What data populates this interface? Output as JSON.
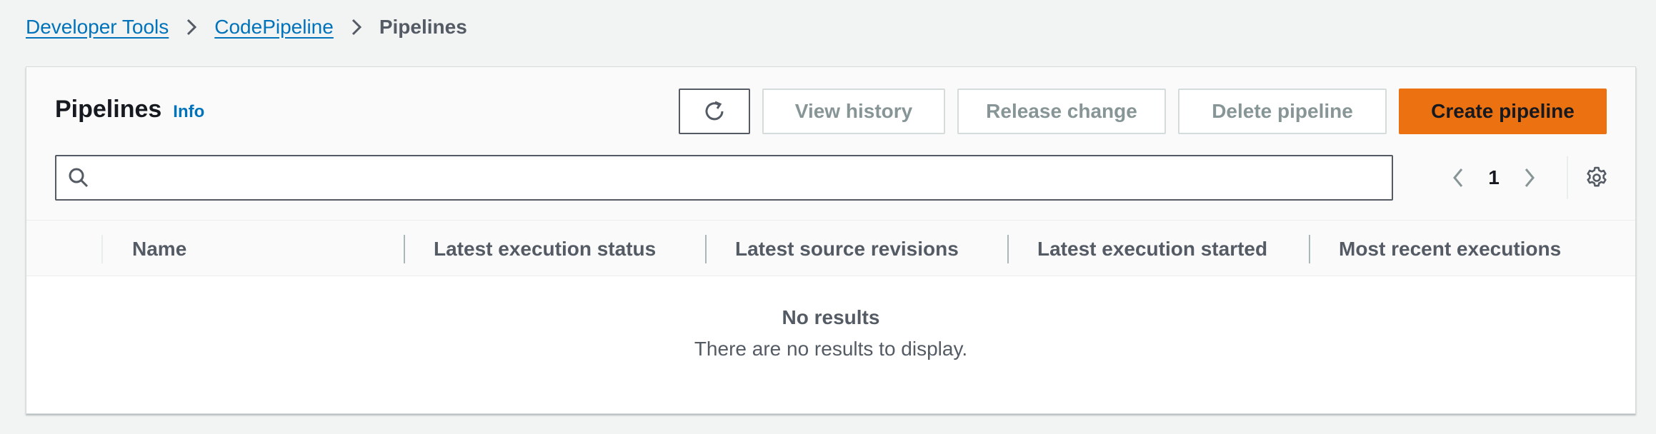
{
  "breadcrumb": {
    "items": [
      "Developer Tools",
      "CodePipeline"
    ],
    "current": "Pipelines"
  },
  "panel": {
    "title": "Pipelines",
    "info": "Info",
    "buttons": {
      "refresh_icon": "refresh-icon",
      "view_history": "View history",
      "release_change": "Release change",
      "delete_pipeline": "Delete pipeline",
      "create_pipeline": "Create pipeline"
    },
    "search": {
      "value": "",
      "placeholder": "",
      "icon": "search-icon"
    },
    "pagination": {
      "current_page": "1"
    }
  },
  "table": {
    "columns": [
      "Name",
      "Latest execution status",
      "Latest source revisions",
      "Latest execution started",
      "Most recent executions"
    ],
    "rows": []
  },
  "empty_state": {
    "title": "No results",
    "message": "There are no results to display."
  },
  "colors": {
    "accent_orange": "#ec7211",
    "link_blue": "#0073bb",
    "background": "#f2f3f3"
  }
}
